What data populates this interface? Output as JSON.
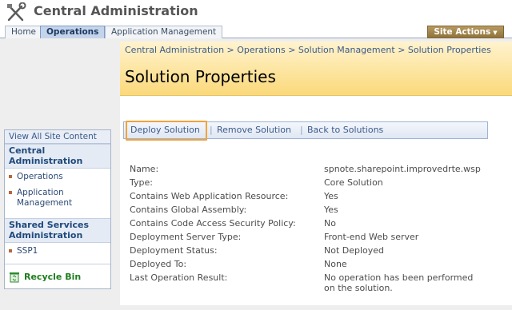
{
  "header": {
    "title": "Central Administration",
    "logo_icon": "tools-icon"
  },
  "topnav": {
    "tabs": [
      {
        "label": "Home",
        "selected": false
      },
      {
        "label": "Operations",
        "selected": true
      },
      {
        "label": "Application Management",
        "selected": false
      }
    ],
    "site_actions_label": "Site Actions"
  },
  "breadcrumb": "Central Administration > Operations > Solution Management > Solution Properties",
  "page_title": "Solution Properties",
  "quick_launch": {
    "view_all": "View All Site Content",
    "groups": [
      {
        "heading": "Central Administration",
        "items": [
          "Operations",
          "Application Management"
        ]
      },
      {
        "heading": "Shared Services Administration",
        "items": [
          "SSP1"
        ]
      }
    ],
    "recycle_bin": "Recycle Bin"
  },
  "toolbar": {
    "deploy": "Deploy Solution",
    "remove": "Remove Solution",
    "back": "Back to Solutions",
    "separator": "|"
  },
  "properties": [
    {
      "label": "Name:",
      "value": "spnote.sharepoint.improvedrte.wsp"
    },
    {
      "label": "Type:",
      "value": "Core Solution"
    },
    {
      "label": "Contains Web Application Resource:",
      "value": "Yes"
    },
    {
      "label": "Contains Global Assembly:",
      "value": "Yes"
    },
    {
      "label": "Contains Code Access Security Policy:",
      "value": "No"
    },
    {
      "label": "Deployment Server Type:",
      "value": "Front-end Web server"
    },
    {
      "label": "Deployment Status:",
      "value": "Not Deployed"
    },
    {
      "label": "Deployed To:",
      "value": "None"
    },
    {
      "label": "Last Operation Result:",
      "value": "No operation has been performed",
      "value_line2": "on the solution."
    }
  ],
  "colors": {
    "title_band": "#fbd97a",
    "site_actions": "#8f733b",
    "highlight": "#f2a33a",
    "link": "#3b5a8c"
  }
}
